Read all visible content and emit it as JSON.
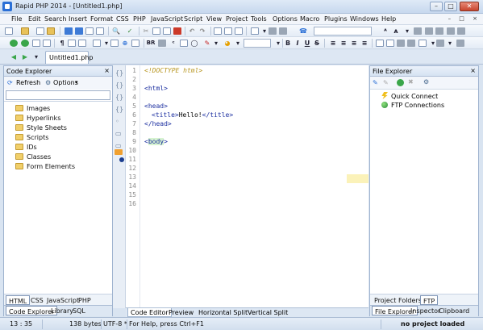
{
  "window": {
    "title": "Rapid PHP 2014 - [Untitled1.php]"
  },
  "menu": [
    "File",
    "Edit",
    "Search",
    "Insert",
    "Format",
    "CSS",
    "PHP",
    "JavaScript",
    "Script",
    "View",
    "Project",
    "Tools",
    "Options",
    "Macro",
    "Plugins",
    "Windows",
    "Help"
  ],
  "toolbar": {
    "br_label": "BR",
    "bold": "B",
    "italic": "I",
    "underline": "U",
    "strike": "S"
  },
  "tabs": {
    "file": "Untitled1.php"
  },
  "code_explorer": {
    "title": "Code Explorer",
    "refresh": "Refresh",
    "options": "Options",
    "search_value": "",
    "items": [
      "Images",
      "Hyperlinks",
      "Style Sheets",
      "Scripts",
      "IDs",
      "Classes",
      "Form Elements"
    ],
    "lang_tabs": [
      "HTML",
      "CSS",
      "JavaScript",
      "PHP"
    ],
    "active_lang": "HTML",
    "bottom_tabs": [
      "Code Explorer",
      "Library",
      "SQL"
    ],
    "active_bottom": "Code Explorer"
  },
  "editor": {
    "line_numbers": [
      "1",
      "2",
      "3",
      "4",
      "5",
      "6",
      "7",
      "8",
      "9",
      "10",
      "11",
      "12",
      "13",
      "14",
      "15",
      "16"
    ],
    "code": {
      "l1": "<!DOCTYPE html>",
      "l3": "<html>",
      "l5": "<head>",
      "l6_open": "<title>",
      "l6_text": "Hello!",
      "l6_close": "</title>",
      "l7": "</head>",
      "l9_lt": "<",
      "l9_body": "body",
      "l9_gt": ">"
    },
    "bottom_tabs": [
      "Code Editor",
      "Preview",
      "Horizontal Split",
      "Vertical Split"
    ],
    "active_tab": "Code Editor"
  },
  "file_explorer": {
    "title": "File Explorer",
    "items": [
      "Quick Connect",
      "FTP Connections"
    ],
    "mid_tabs": [
      "Project",
      "Folders",
      "FTP"
    ],
    "active_mid": "FTP",
    "bottom_tabs": [
      "File Explorer",
      "Inspector",
      "Clipboard"
    ],
    "active_bottom": "File Explorer"
  },
  "status": {
    "position": "13 : 35",
    "size": "138 bytes",
    "encoding": "UTF-8 *",
    "help": "For Help, press Ctrl+F1",
    "project": "no project loaded"
  }
}
